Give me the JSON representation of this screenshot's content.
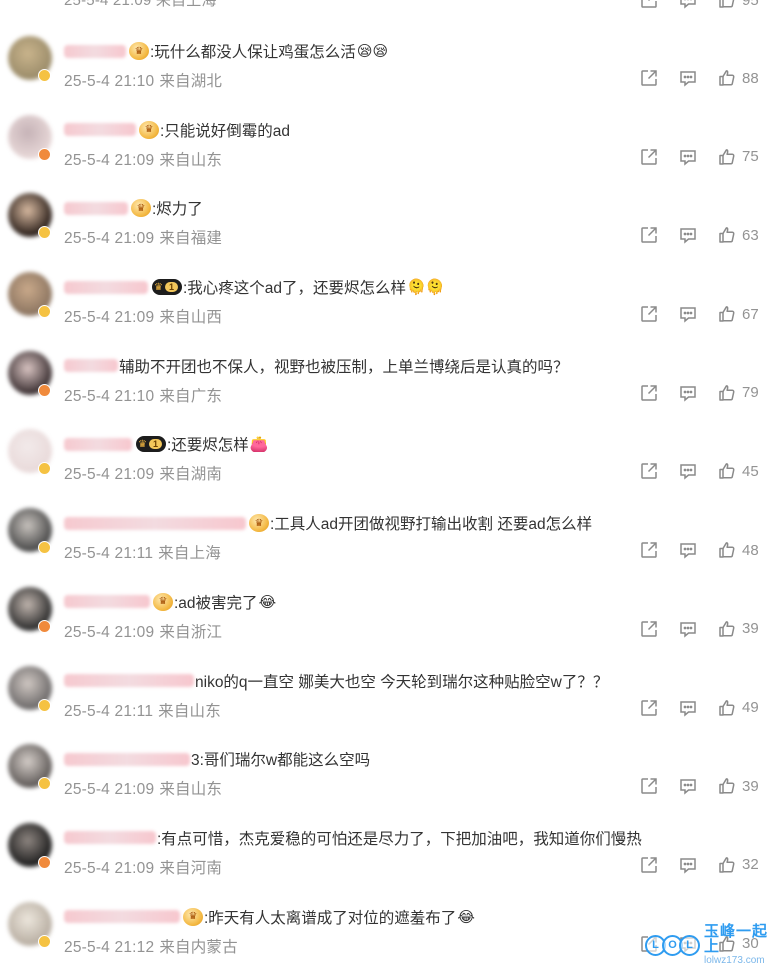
{
  "top_partial": {
    "meta": "25-5-4 21:09 来自上海",
    "likes": "95"
  },
  "comments": [
    {
      "text": ":玩什么都没人保让鸡蛋怎么活",
      "emoji": "😪😪",
      "time": "25-5-4 21:10",
      "loc": "来自湖北",
      "likes": "88",
      "vip": true,
      "level": false,
      "avatar": [
        "#9b8c6a",
        "#c9b48c"
      ]
    },
    {
      "text": ":只能说好倒霉的ad",
      "emoji": "",
      "time": "25-5-4 21:09",
      "loc": "来自山东",
      "likes": "75",
      "vip": true,
      "level": false,
      "avatar": [
        "#e7d7d7",
        "#c6b3b7"
      ]
    },
    {
      "text": ":烬力了",
      "emoji": "",
      "time": "25-5-4 21:09",
      "loc": "来自福建",
      "likes": "63",
      "vip": true,
      "level": false,
      "avatar": [
        "#2a1f1a",
        "#d7b9a0"
      ]
    },
    {
      "text": ":我心疼这个ad了，还要烬怎么样",
      "emoji": "🫠🫠",
      "time": "25-5-4 21:09",
      "loc": "来自山西",
      "likes": "67",
      "vip": false,
      "level": true,
      "level_num": "1",
      "avatar": [
        "#8c7561",
        "#c9a98a"
      ]
    },
    {
      "text": "辅助不开团也不保人，视野也被压制，上单兰博绕后是认真的吗？",
      "emoji": "",
      "time": "25-5-4 21:10",
      "loc": "来自广东",
      "likes": "79",
      "vip": false,
      "level": false,
      "avatar": [
        "#3b3032",
        "#d9c4c2"
      ]
    },
    {
      "text": ":还要烬怎样",
      "emoji": "👛",
      "time": "25-5-4 21:09",
      "loc": "来自湖南",
      "likes": "45",
      "vip": false,
      "level": true,
      "level_num": "1",
      "avatar": [
        "#e9dada",
        "#f2eaea"
      ]
    },
    {
      "text": ":工具人ad开团做视野打输出收割 还要ad怎么样",
      "emoji": "",
      "time": "25-5-4 21:11",
      "loc": "来自上海",
      "likes": "48",
      "vip": true,
      "level": false,
      "avatar": [
        "#4a4a4a",
        "#c7c2bd"
      ]
    },
    {
      "text": ":ad被害完了",
      "emoji": "😂",
      "time": "25-5-4 21:09",
      "loc": "来自浙江",
      "likes": "39",
      "vip": true,
      "level": false,
      "avatar": [
        "#2d2d2d",
        "#bfb4ad"
      ]
    },
    {
      "text": "niko的q一直空  娜美大也空 今天轮到瑞尔这种贴脸空w了？？",
      "emoji": "",
      "time": "25-5-4 21:11",
      "loc": "来自山东",
      "likes": "49",
      "vip": false,
      "level": false,
      "avatar": [
        "#6d6a6a",
        "#cfc7c2"
      ]
    },
    {
      "text": "3:哥们瑞尔w都能这么空吗",
      "emoji": "",
      "time": "25-5-4 21:09",
      "loc": "来自山东",
      "likes": "39",
      "vip": false,
      "level": false,
      "avatar": [
        "#5f5a58",
        "#d3ccc7"
      ]
    },
    {
      "text": ":有点可惜，杰克爱稳的可怕还是尽力了，下把加油吧，我知道你们慢热",
      "emoji": "",
      "time": "25-5-4 21:09",
      "loc": "来自河南",
      "likes": "32",
      "vip": false,
      "level": false,
      "avatar": [
        "#1e1e1e",
        "#8d8580"
      ]
    },
    {
      "text": ":昨天有人太离谱成了对位的遮羞布了",
      "emoji": "😂",
      "time": "25-5-4 21:12",
      "loc": "来自内蒙古",
      "likes": "30",
      "vip": true,
      "level": false,
      "avatar": [
        "#b8aea2",
        "#ece6dc"
      ]
    }
  ],
  "name_widths": [
    62,
    72,
    64,
    84,
    54,
    68,
    182,
    86,
    130,
    126,
    92,
    116
  ],
  "watermark": {
    "mark": "LOL",
    "cn": "玉峰一起上",
    "url": "lolwz173.com"
  },
  "colors": {
    "meta": "#939393",
    "text": "#333333",
    "badge_yellow": "#f5c242",
    "badge_orange": "#f08a3c",
    "watermark": "#2f9cf0"
  }
}
